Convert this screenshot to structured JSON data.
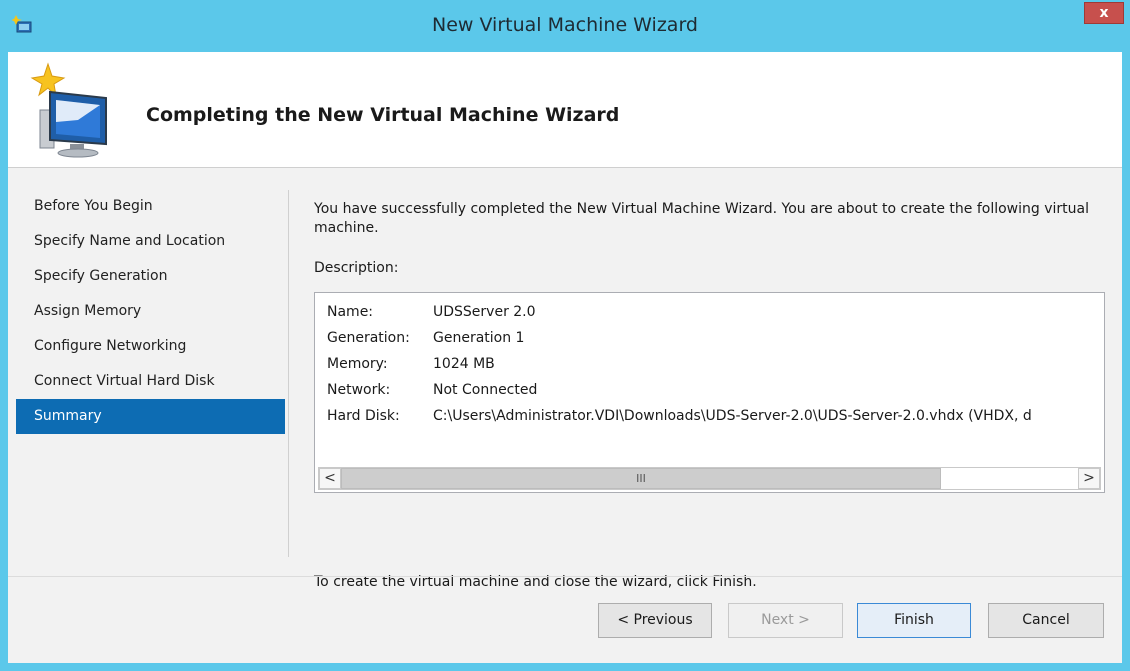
{
  "window": {
    "title": "New Virtual Machine Wizard",
    "close_label": "x"
  },
  "header": {
    "title": "Completing the New Virtual Machine Wizard"
  },
  "nav": {
    "items": [
      {
        "label": "Before You Begin"
      },
      {
        "label": "Specify Name and Location"
      },
      {
        "label": "Specify Generation"
      },
      {
        "label": "Assign Memory"
      },
      {
        "label": "Configure Networking"
      },
      {
        "label": "Connect Virtual Hard Disk"
      },
      {
        "label": "Summary",
        "selected": true
      }
    ]
  },
  "content": {
    "intro": "You have successfully completed the New Virtual Machine Wizard. You are about to create the following virtual machine.",
    "description_label": "Description:",
    "description_rows": [
      {
        "key": "Name:",
        "value": "UDSServer 2.0"
      },
      {
        "key": "Generation:",
        "value": "Generation 1"
      },
      {
        "key": "Memory:",
        "value": "1024 MB"
      },
      {
        "key": "Network:",
        "value": "Not Connected"
      },
      {
        "key": "Hard Disk:",
        "value": "C:\\Users\\Administrator.VDI\\Downloads\\UDS-Server-2.0\\UDS-Server-2.0.vhdx (VHDX, d"
      }
    ],
    "scroll_left": "<",
    "scroll_right": ">",
    "scroll_thumb": "III",
    "finish_text": "To create the virtual machine and close the wizard, click Finish."
  },
  "buttons": {
    "previous": "< Previous",
    "next": "Next >",
    "finish": "Finish",
    "cancel": "Cancel"
  },
  "colors": {
    "titlebar": "#5bc8ea",
    "selected_nav": "#0d6cb3",
    "close_button": "#c7504d"
  }
}
